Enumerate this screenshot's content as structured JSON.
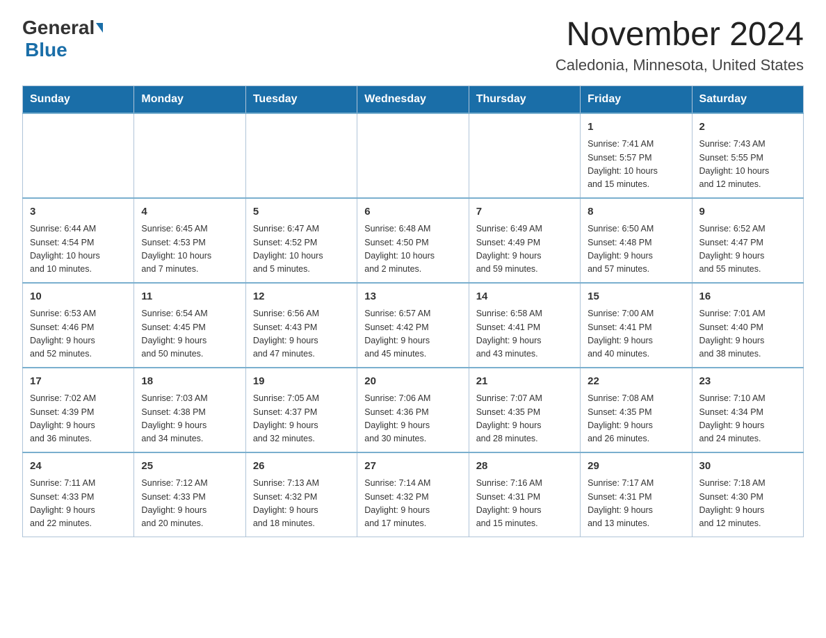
{
  "header": {
    "logo_general": "General",
    "logo_blue": "Blue",
    "month_year": "November 2024",
    "location": "Caledonia, Minnesota, United States"
  },
  "weekdays": [
    "Sunday",
    "Monday",
    "Tuesday",
    "Wednesday",
    "Thursday",
    "Friday",
    "Saturday"
  ],
  "weeks": [
    [
      {
        "day": "",
        "info": ""
      },
      {
        "day": "",
        "info": ""
      },
      {
        "day": "",
        "info": ""
      },
      {
        "day": "",
        "info": ""
      },
      {
        "day": "",
        "info": ""
      },
      {
        "day": "1",
        "info": "Sunrise: 7:41 AM\nSunset: 5:57 PM\nDaylight: 10 hours\nand 15 minutes."
      },
      {
        "day": "2",
        "info": "Sunrise: 7:43 AM\nSunset: 5:55 PM\nDaylight: 10 hours\nand 12 minutes."
      }
    ],
    [
      {
        "day": "3",
        "info": "Sunrise: 6:44 AM\nSunset: 4:54 PM\nDaylight: 10 hours\nand 10 minutes."
      },
      {
        "day": "4",
        "info": "Sunrise: 6:45 AM\nSunset: 4:53 PM\nDaylight: 10 hours\nand 7 minutes."
      },
      {
        "day": "5",
        "info": "Sunrise: 6:47 AM\nSunset: 4:52 PM\nDaylight: 10 hours\nand 5 minutes."
      },
      {
        "day": "6",
        "info": "Sunrise: 6:48 AM\nSunset: 4:50 PM\nDaylight: 10 hours\nand 2 minutes."
      },
      {
        "day": "7",
        "info": "Sunrise: 6:49 AM\nSunset: 4:49 PM\nDaylight: 9 hours\nand 59 minutes."
      },
      {
        "day": "8",
        "info": "Sunrise: 6:50 AM\nSunset: 4:48 PM\nDaylight: 9 hours\nand 57 minutes."
      },
      {
        "day": "9",
        "info": "Sunrise: 6:52 AM\nSunset: 4:47 PM\nDaylight: 9 hours\nand 55 minutes."
      }
    ],
    [
      {
        "day": "10",
        "info": "Sunrise: 6:53 AM\nSunset: 4:46 PM\nDaylight: 9 hours\nand 52 minutes."
      },
      {
        "day": "11",
        "info": "Sunrise: 6:54 AM\nSunset: 4:45 PM\nDaylight: 9 hours\nand 50 minutes."
      },
      {
        "day": "12",
        "info": "Sunrise: 6:56 AM\nSunset: 4:43 PM\nDaylight: 9 hours\nand 47 minutes."
      },
      {
        "day": "13",
        "info": "Sunrise: 6:57 AM\nSunset: 4:42 PM\nDaylight: 9 hours\nand 45 minutes."
      },
      {
        "day": "14",
        "info": "Sunrise: 6:58 AM\nSunset: 4:41 PM\nDaylight: 9 hours\nand 43 minutes."
      },
      {
        "day": "15",
        "info": "Sunrise: 7:00 AM\nSunset: 4:41 PM\nDaylight: 9 hours\nand 40 minutes."
      },
      {
        "day": "16",
        "info": "Sunrise: 7:01 AM\nSunset: 4:40 PM\nDaylight: 9 hours\nand 38 minutes."
      }
    ],
    [
      {
        "day": "17",
        "info": "Sunrise: 7:02 AM\nSunset: 4:39 PM\nDaylight: 9 hours\nand 36 minutes."
      },
      {
        "day": "18",
        "info": "Sunrise: 7:03 AM\nSunset: 4:38 PM\nDaylight: 9 hours\nand 34 minutes."
      },
      {
        "day": "19",
        "info": "Sunrise: 7:05 AM\nSunset: 4:37 PM\nDaylight: 9 hours\nand 32 minutes."
      },
      {
        "day": "20",
        "info": "Sunrise: 7:06 AM\nSunset: 4:36 PM\nDaylight: 9 hours\nand 30 minutes."
      },
      {
        "day": "21",
        "info": "Sunrise: 7:07 AM\nSunset: 4:35 PM\nDaylight: 9 hours\nand 28 minutes."
      },
      {
        "day": "22",
        "info": "Sunrise: 7:08 AM\nSunset: 4:35 PM\nDaylight: 9 hours\nand 26 minutes."
      },
      {
        "day": "23",
        "info": "Sunrise: 7:10 AM\nSunset: 4:34 PM\nDaylight: 9 hours\nand 24 minutes."
      }
    ],
    [
      {
        "day": "24",
        "info": "Sunrise: 7:11 AM\nSunset: 4:33 PM\nDaylight: 9 hours\nand 22 minutes."
      },
      {
        "day": "25",
        "info": "Sunrise: 7:12 AM\nSunset: 4:33 PM\nDaylight: 9 hours\nand 20 minutes."
      },
      {
        "day": "26",
        "info": "Sunrise: 7:13 AM\nSunset: 4:32 PM\nDaylight: 9 hours\nand 18 minutes."
      },
      {
        "day": "27",
        "info": "Sunrise: 7:14 AM\nSunset: 4:32 PM\nDaylight: 9 hours\nand 17 minutes."
      },
      {
        "day": "28",
        "info": "Sunrise: 7:16 AM\nSunset: 4:31 PM\nDaylight: 9 hours\nand 15 minutes."
      },
      {
        "day": "29",
        "info": "Sunrise: 7:17 AM\nSunset: 4:31 PM\nDaylight: 9 hours\nand 13 minutes."
      },
      {
        "day": "30",
        "info": "Sunrise: 7:18 AM\nSunset: 4:30 PM\nDaylight: 9 hours\nand 12 minutes."
      }
    ]
  ]
}
